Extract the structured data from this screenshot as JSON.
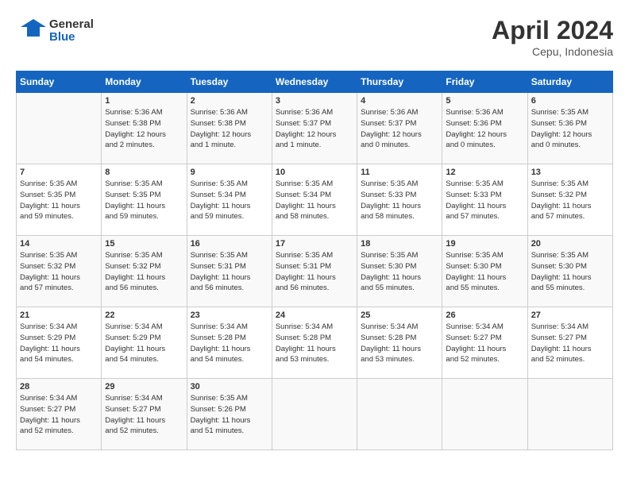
{
  "header": {
    "logo_line1": "General",
    "logo_line2": "Blue",
    "title": "April 2024",
    "location": "Cepu, Indonesia"
  },
  "days_of_week": [
    "Sunday",
    "Monday",
    "Tuesday",
    "Wednesday",
    "Thursday",
    "Friday",
    "Saturday"
  ],
  "weeks": [
    [
      {
        "day": "",
        "info": ""
      },
      {
        "day": "1",
        "info": "Sunrise: 5:36 AM\nSunset: 5:38 PM\nDaylight: 12 hours\nand 2 minutes."
      },
      {
        "day": "2",
        "info": "Sunrise: 5:36 AM\nSunset: 5:38 PM\nDaylight: 12 hours\nand 1 minute."
      },
      {
        "day": "3",
        "info": "Sunrise: 5:36 AM\nSunset: 5:37 PM\nDaylight: 12 hours\nand 1 minute."
      },
      {
        "day": "4",
        "info": "Sunrise: 5:36 AM\nSunset: 5:37 PM\nDaylight: 12 hours\nand 0 minutes."
      },
      {
        "day": "5",
        "info": "Sunrise: 5:36 AM\nSunset: 5:36 PM\nDaylight: 12 hours\nand 0 minutes."
      },
      {
        "day": "6",
        "info": "Sunrise: 5:35 AM\nSunset: 5:36 PM\nDaylight: 12 hours\nand 0 minutes."
      }
    ],
    [
      {
        "day": "7",
        "info": "Sunrise: 5:35 AM\nSunset: 5:35 PM\nDaylight: 11 hours\nand 59 minutes."
      },
      {
        "day": "8",
        "info": "Sunrise: 5:35 AM\nSunset: 5:35 PM\nDaylight: 11 hours\nand 59 minutes."
      },
      {
        "day": "9",
        "info": "Sunrise: 5:35 AM\nSunset: 5:34 PM\nDaylight: 11 hours\nand 59 minutes."
      },
      {
        "day": "10",
        "info": "Sunrise: 5:35 AM\nSunset: 5:34 PM\nDaylight: 11 hours\nand 58 minutes."
      },
      {
        "day": "11",
        "info": "Sunrise: 5:35 AM\nSunset: 5:33 PM\nDaylight: 11 hours\nand 58 minutes."
      },
      {
        "day": "12",
        "info": "Sunrise: 5:35 AM\nSunset: 5:33 PM\nDaylight: 11 hours\nand 57 minutes."
      },
      {
        "day": "13",
        "info": "Sunrise: 5:35 AM\nSunset: 5:32 PM\nDaylight: 11 hours\nand 57 minutes."
      }
    ],
    [
      {
        "day": "14",
        "info": "Sunrise: 5:35 AM\nSunset: 5:32 PM\nDaylight: 11 hours\nand 57 minutes."
      },
      {
        "day": "15",
        "info": "Sunrise: 5:35 AM\nSunset: 5:32 PM\nDaylight: 11 hours\nand 56 minutes."
      },
      {
        "day": "16",
        "info": "Sunrise: 5:35 AM\nSunset: 5:31 PM\nDaylight: 11 hours\nand 56 minutes."
      },
      {
        "day": "17",
        "info": "Sunrise: 5:35 AM\nSunset: 5:31 PM\nDaylight: 11 hours\nand 56 minutes."
      },
      {
        "day": "18",
        "info": "Sunrise: 5:35 AM\nSunset: 5:30 PM\nDaylight: 11 hours\nand 55 minutes."
      },
      {
        "day": "19",
        "info": "Sunrise: 5:35 AM\nSunset: 5:30 PM\nDaylight: 11 hours\nand 55 minutes."
      },
      {
        "day": "20",
        "info": "Sunrise: 5:35 AM\nSunset: 5:30 PM\nDaylight: 11 hours\nand 55 minutes."
      }
    ],
    [
      {
        "day": "21",
        "info": "Sunrise: 5:34 AM\nSunset: 5:29 PM\nDaylight: 11 hours\nand 54 minutes."
      },
      {
        "day": "22",
        "info": "Sunrise: 5:34 AM\nSunset: 5:29 PM\nDaylight: 11 hours\nand 54 minutes."
      },
      {
        "day": "23",
        "info": "Sunrise: 5:34 AM\nSunset: 5:28 PM\nDaylight: 11 hours\nand 54 minutes."
      },
      {
        "day": "24",
        "info": "Sunrise: 5:34 AM\nSunset: 5:28 PM\nDaylight: 11 hours\nand 53 minutes."
      },
      {
        "day": "25",
        "info": "Sunrise: 5:34 AM\nSunset: 5:28 PM\nDaylight: 11 hours\nand 53 minutes."
      },
      {
        "day": "26",
        "info": "Sunrise: 5:34 AM\nSunset: 5:27 PM\nDaylight: 11 hours\nand 52 minutes."
      },
      {
        "day": "27",
        "info": "Sunrise: 5:34 AM\nSunset: 5:27 PM\nDaylight: 11 hours\nand 52 minutes."
      }
    ],
    [
      {
        "day": "28",
        "info": "Sunrise: 5:34 AM\nSunset: 5:27 PM\nDaylight: 11 hours\nand 52 minutes."
      },
      {
        "day": "29",
        "info": "Sunrise: 5:34 AM\nSunset: 5:27 PM\nDaylight: 11 hours\nand 52 minutes."
      },
      {
        "day": "30",
        "info": "Sunrise: 5:35 AM\nSunset: 5:26 PM\nDaylight: 11 hours\nand 51 minutes."
      },
      {
        "day": "",
        "info": ""
      },
      {
        "day": "",
        "info": ""
      },
      {
        "day": "",
        "info": ""
      },
      {
        "day": "",
        "info": ""
      }
    ]
  ]
}
